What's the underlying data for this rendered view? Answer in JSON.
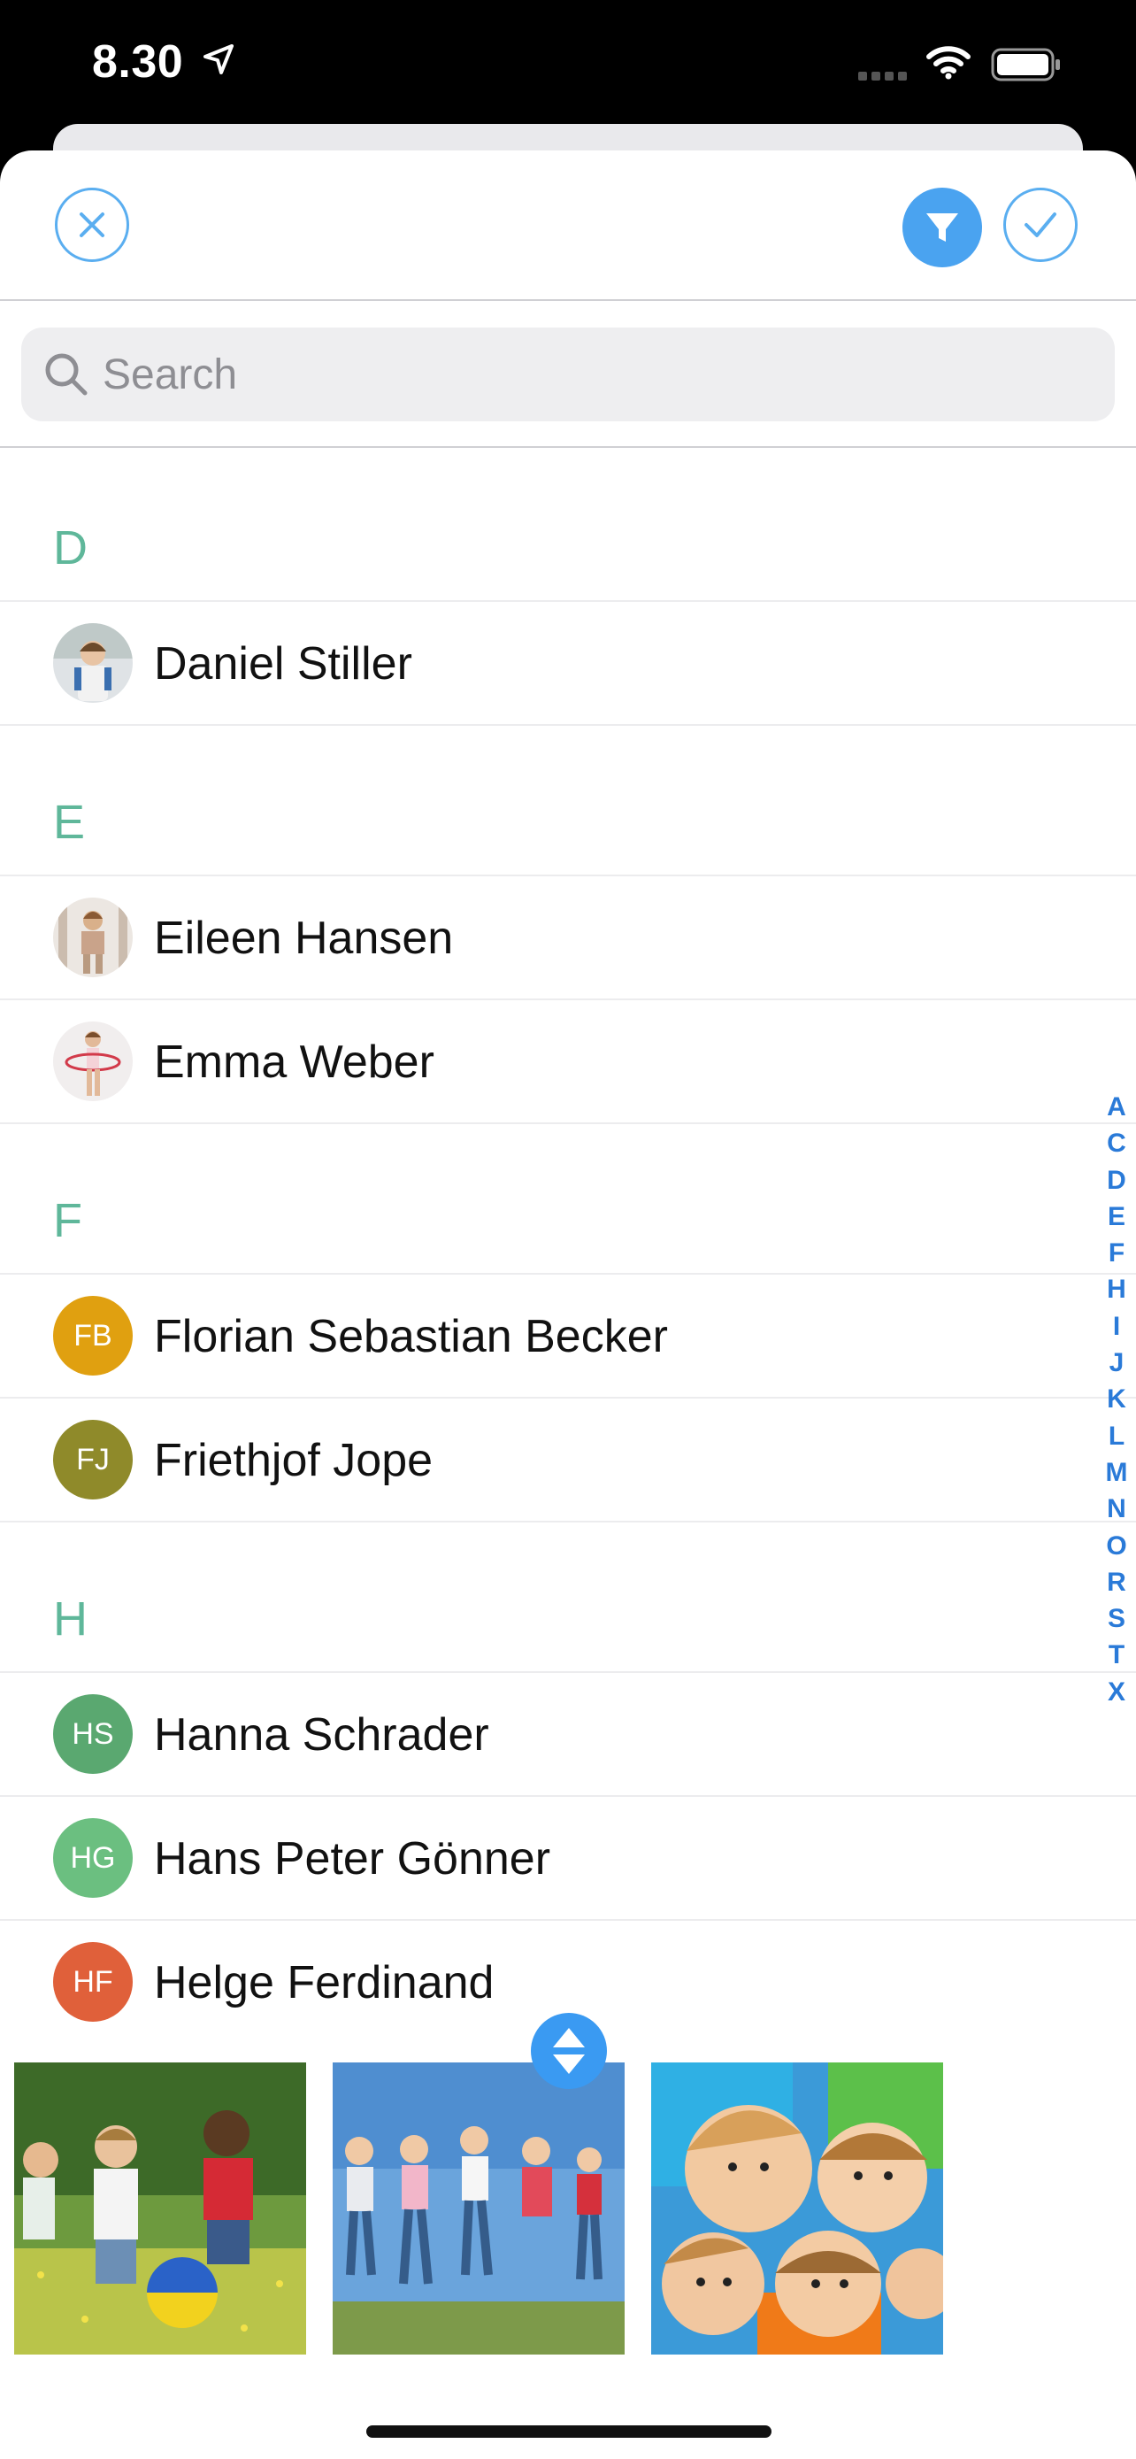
{
  "status": {
    "time": "8.30"
  },
  "search": {
    "placeholder": "Search"
  },
  "sections": [
    {
      "letter": "D",
      "contacts": [
        {
          "name": "Daniel Stiller",
          "initials": "",
          "photo": "kid-photo"
        }
      ]
    },
    {
      "letter": "E",
      "contacts": [
        {
          "name": "Eileen Hansen",
          "initials": "",
          "photo": "kid-photo"
        },
        {
          "name": "Emma Weber",
          "initials": "",
          "photo": "kid-photo"
        }
      ]
    },
    {
      "letter": "F",
      "contacts": [
        {
          "name": "Florian Sebastian Becker",
          "initials": "FB",
          "color": "#e0a010"
        },
        {
          "name": "Friethjof Jope",
          "initials": "FJ",
          "color": "#8f8a2a"
        }
      ]
    },
    {
      "letter": "H",
      "contacts": [
        {
          "name": "Hanna Schrader",
          "initials": "HS",
          "color": "#5aa870"
        },
        {
          "name": "Hans Peter Gönner",
          "initials": "HG",
          "color": "#6bbf80"
        },
        {
          "name": "Helge Ferdinand",
          "initials": "HF",
          "color": "#e0603a"
        }
      ]
    }
  ],
  "index_letters": [
    "A",
    "C",
    "D",
    "E",
    "F",
    "H",
    "I",
    "J",
    "K",
    "L",
    "M",
    "N",
    "O",
    "R",
    "S",
    "T",
    "X"
  ],
  "colors": {
    "accent": "#4aa3f0",
    "section_header": "#5fb79a",
    "index": "#2a7ad8"
  }
}
